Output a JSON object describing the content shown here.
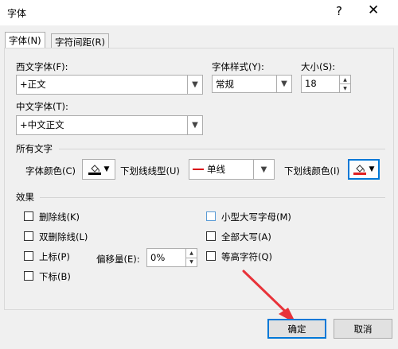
{
  "window": {
    "title": "字体",
    "help": "?",
    "close": "✕"
  },
  "tabs": [
    {
      "label": "字体(N)"
    },
    {
      "label": "字符间距(R)"
    }
  ],
  "font": {
    "western_label": "西文字体(F):",
    "western_value": "+正文",
    "style_label": "字体样式(Y):",
    "style_value": "常规",
    "size_label": "大小(S):",
    "size_value": "18",
    "chinese_label": "中文字体(T):",
    "chinese_value": "+中文正文"
  },
  "all_text": {
    "section_label": "所有文字",
    "font_color_label": "字体颜色(C)",
    "underline_type_label": "下划线线型(U)",
    "underline_type_value": "单线",
    "underline_color_label": "下划线颜色(I)"
  },
  "effects": {
    "section_label": "效果",
    "strikethrough": "删除线(K)",
    "double_strikethrough": "双删除线(L)",
    "superscript": "上标(P)",
    "subscript": "下标(B)",
    "offset_label": "偏移量(E):",
    "offset_value": "0%",
    "small_caps": "小型大写字母(M)",
    "all_caps": "全部大写(A)",
    "equal_height": "等高字符(Q)"
  },
  "buttons": {
    "ok": "确定",
    "cancel": "取消"
  },
  "colors": {
    "font_color": "#000000",
    "underline_color": "#e02020",
    "underline_line": "#d9000d",
    "arrow": "#e8333a",
    "focus": "#0078d7"
  }
}
